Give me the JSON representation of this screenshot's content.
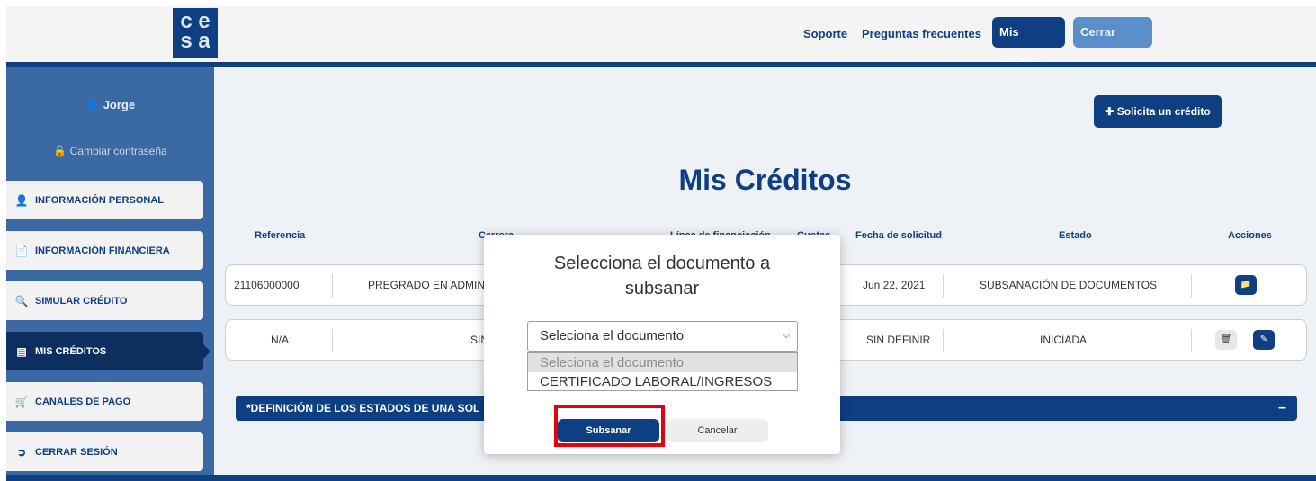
{
  "header": {
    "logo_text": "cesa",
    "links": [
      "Soporte",
      "Preguntas frecuentes"
    ],
    "mis_creditos": "Mis créditos",
    "cerrar_sesion": "Cerrar sesión"
  },
  "sidebar": {
    "user_name": "Jorge",
    "change_password": "Cambiar contraseña",
    "items": [
      {
        "label": "INFORMACIÓN PERSONAL",
        "icon": "user-icon"
      },
      {
        "label": "INFORMACIÓN FINANCIERA",
        "icon": "document-icon"
      },
      {
        "label": "SIMULAR CRÉDITO",
        "icon": "search-icon"
      },
      {
        "label": "MIS CRÉDITOS",
        "icon": "card-icon",
        "active": true
      },
      {
        "label": "CANALES DE PAGO",
        "icon": "cart-icon"
      },
      {
        "label": "CERRAR SESIÓN",
        "icon": "logout-icon"
      }
    ]
  },
  "main": {
    "solicita_label": "Solicita un crédito",
    "title": "Mis Créditos",
    "columns": [
      "Referencia",
      "Carrera",
      "Línea de financiación",
      "Cuotas",
      "Fecha de solicitud",
      "Estado",
      "Acciones"
    ],
    "rows": [
      {
        "referencia": "21106000000",
        "carrera": "PREGRADO EN ADMIN",
        "fecha": "Jun 22, 2021",
        "estado": "SUBSANACIÓN DE DOCUMENTOS"
      },
      {
        "referencia": "N/A",
        "carrera": "SIN",
        "fecha": "SIN DEFINIR",
        "estado": "INICIADA"
      }
    ],
    "definition_bar": "*DEFINICIÓN DE LOS ESTADOS DE UNA SOL",
    "definition_toggle": "–"
  },
  "modal": {
    "title": "Selecciona el documento a subsanar",
    "select_value": "Seleciona el documento",
    "options": [
      "Seleciona el documento",
      "CERTIFICADO LABORAL/INGRESOS"
    ],
    "submit_label": "Subsanar",
    "cancel_label": "Cancelar",
    "highlight_color": "#e3000f"
  },
  "colors": {
    "brand": "#0d3f82",
    "sidebar": "#3a69a3"
  }
}
